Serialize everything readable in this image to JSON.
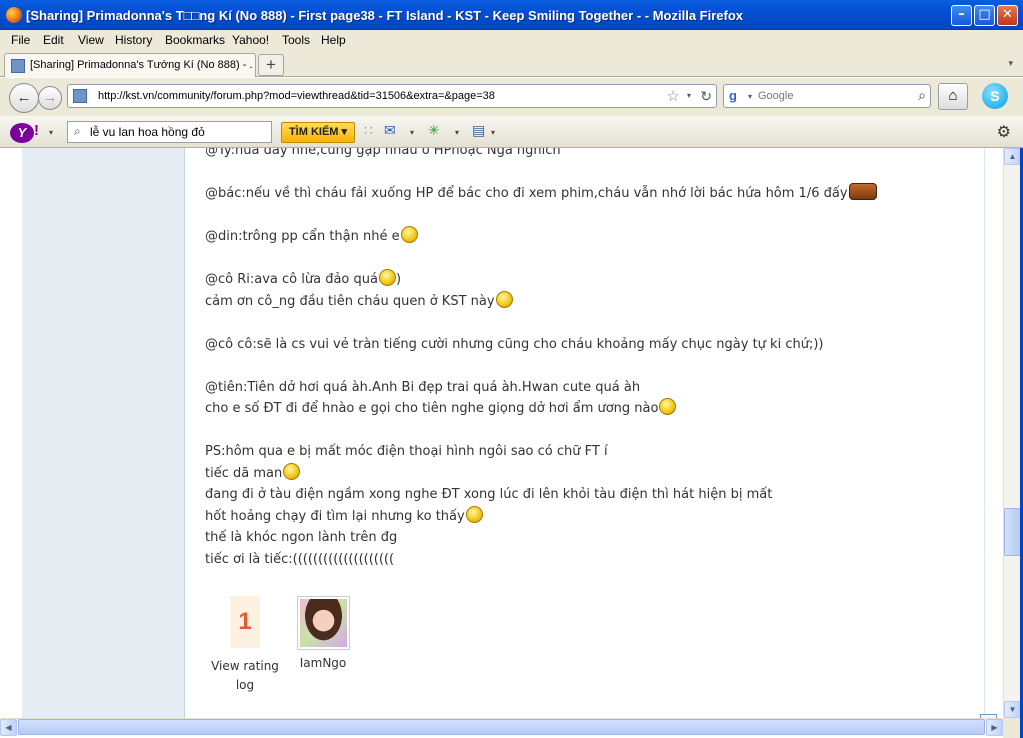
{
  "window": {
    "title": "[Sharing] Primadonna's T□□ng Kí (No 888) - First page38 - FT Island - KST - Keep Smiling Together - - Mozilla Firefox",
    "minimize": "–",
    "maximize": "□",
    "close": "✕"
  },
  "menu": [
    "File",
    "Edit",
    "View",
    "History",
    "Bookmarks",
    "Yahoo!",
    "Tools",
    "Help"
  ],
  "tab": {
    "label": "[Sharing] Primadonna's Tướng Kí (No 888) - ...",
    "new_tab": "+",
    "scroll": "▾"
  },
  "nav": {
    "back": "←",
    "forward": "→",
    "url": "http://kst.vn/community/forum.php?mod=viewthread&tid=31506&extra=&page=38",
    "star": "☆",
    "drop": "▾",
    "reload": "↻",
    "search_engine": "g",
    "search_drop": "▾",
    "search_placeholder": "Google",
    "search_go": "⌕",
    "home": "⌂",
    "skype": "S"
  },
  "yahoo_toolbar": {
    "logo": "Y",
    "logo_excl": "!",
    "logo_drop": "▾",
    "search_glyph": "⌕",
    "search_value": "lễ vu lan hoa hồng đỏ",
    "search_button": "TÌM KIẾM ▾",
    "divider": "∷",
    "mail": "✉",
    "mail_drop": "▾",
    "widget": "✳",
    "widget_drop": "▾",
    "bookmarks": "▤",
    "bookmarks_drop": "▾",
    "settings": "⚙"
  },
  "post": {
    "lines": [
      "@Ty:hứa đây nhé,cùng gặp nhau ở HPhoặc Nga nghich",
      "",
      "@bác:nếu về thì cháu fải xuống HP để bác cho đi xem phim,cháu vẫn nhớ lời bác hứa hôm 1/6 đấy",
      "",
      "@din:trông pp cẩn thận nhé e",
      "",
      "@cô Ri:ava cô lừa đảo quá",
      "cảm ơn cô_ng đầu tiên cháu quen ở KST này",
      "",
      "@cô cô:sẽ là cs vui vẻ tràn tiếng cười nhưng cũng cho cháu khoảng mấy chục ngày tự ki chứ;))",
      "",
      "@tiên:Tiên dở hơi quá àh.Anh Bi đẹp trai quá àh.Hwan cute quá àh",
      "cho e số ĐT đi để hnào e gọi cho tiên nghe giọng dở hơi ẩm ương nào",
      "",
      "PS:hôm qua e bị mất móc điện thoại hình ngôi sao có chữ FT í",
      "tiếc dã man",
      "đang đi ở tàu điện ngầm xong nghe ĐT xong lúc đi lên khỏi tàu điện thì hát hiện bị mất",
      "hốt hoảng chạy đi tìm lại nhưng ko thấy",
      "thế là khóc ngon lành trên đg",
      "tiếc ơi là tiếc:(((((((((((((((((((("
    ],
    "line_7_suffix": ")"
  },
  "rating": {
    "value": "1",
    "label": "View rating log"
  },
  "rater": {
    "name": "IamNgo"
  },
  "up_button": "UP",
  "scroll": {
    "up": "▲",
    "down": "▼",
    "left": "◀",
    "right": "▶"
  }
}
